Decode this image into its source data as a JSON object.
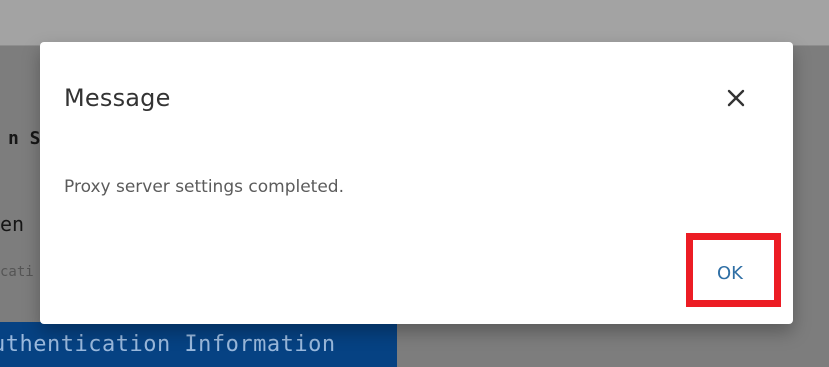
{
  "background": {
    "heading_fragment": "n S",
    "line_fragment": "en",
    "small_fragment": "cati",
    "auth_button_label": "uthentication Information"
  },
  "dialog": {
    "title": "Message",
    "message": "Proxy server settings completed.",
    "ok_label": "OK",
    "close_icon": "close-icon"
  },
  "colors": {
    "overlay": "#7d7d7d",
    "auth_button": "#064283",
    "ok_text": "#2f6fa5",
    "highlight": "#ec1c24"
  }
}
